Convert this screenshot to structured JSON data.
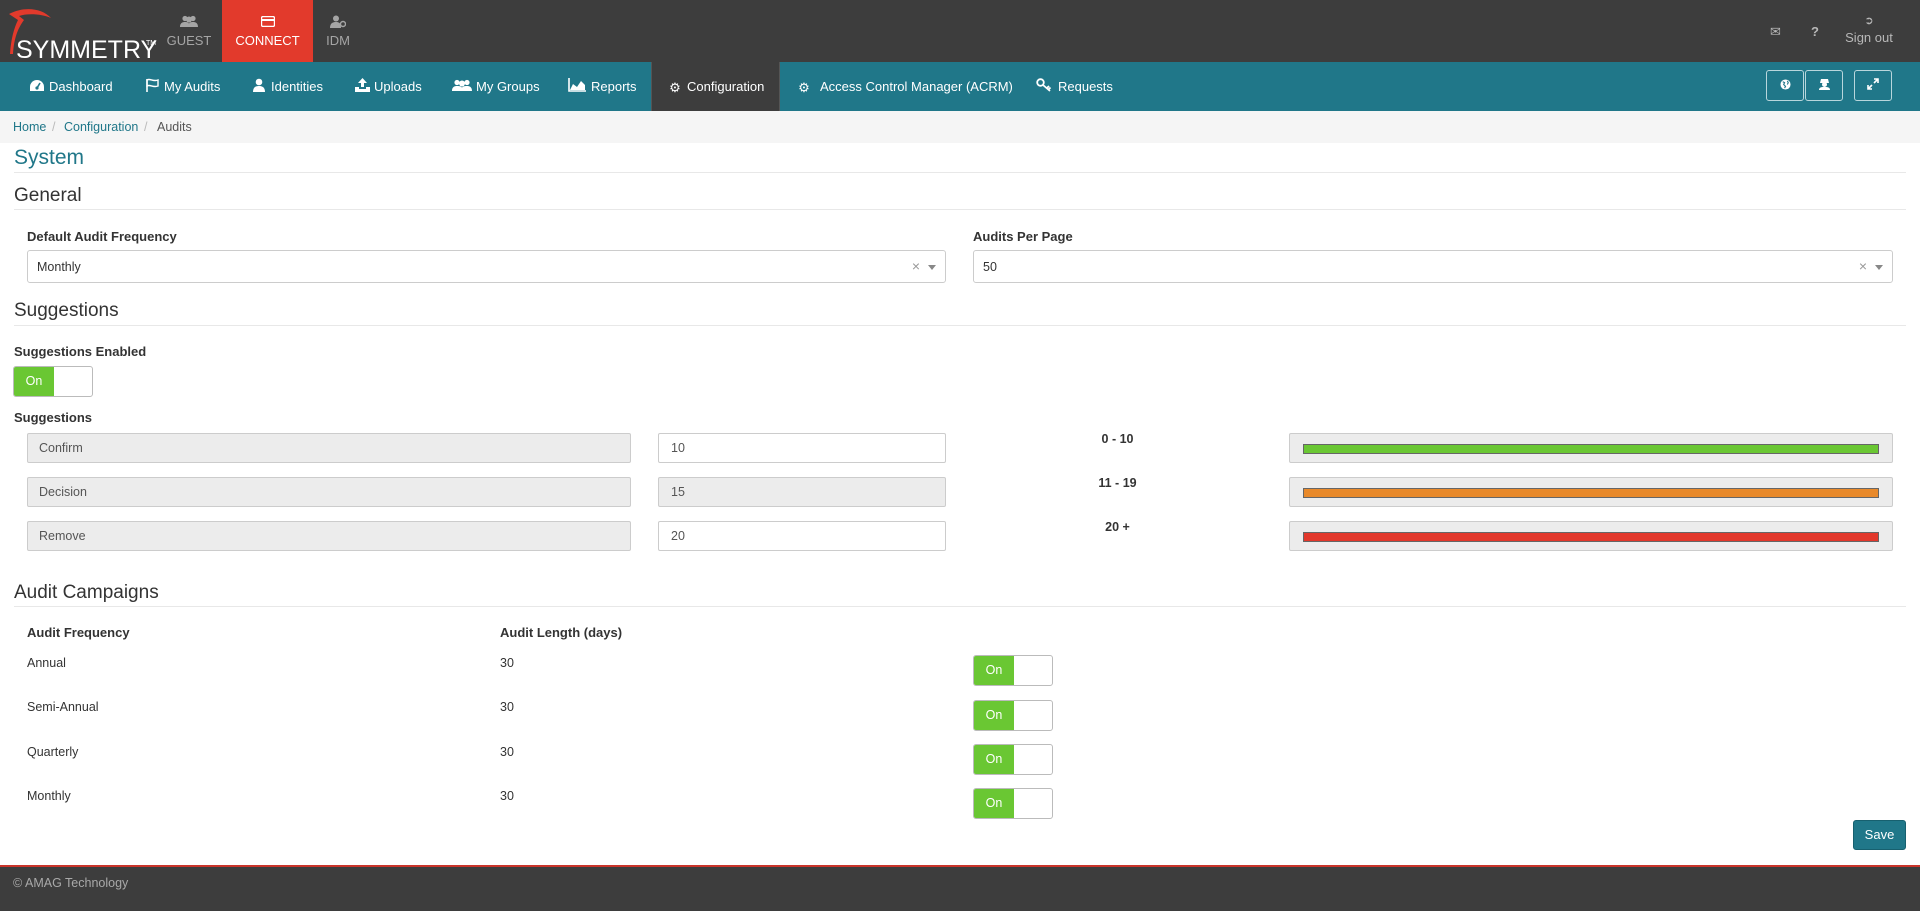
{
  "brand": {
    "name": "SYMMETRY",
    "tm": "TM"
  },
  "app_tabs": [
    {
      "label": "GUEST",
      "icon": "users-icon"
    },
    {
      "label": "CONNECT",
      "icon": "card-icon",
      "active": true
    },
    {
      "label": "IDM",
      "icon": "user-gear-icon"
    }
  ],
  "topbar": {
    "signout": "Sign out"
  },
  "nav": {
    "items": [
      {
        "label": "Dashboard",
        "icon": "dashboard-icon"
      },
      {
        "label": "My Audits",
        "icon": "flag-icon"
      },
      {
        "label": "Identities",
        "icon": "user-icon"
      },
      {
        "label": "Uploads",
        "icon": "upload-icon"
      },
      {
        "label": "My Groups",
        "icon": "group-icon"
      },
      {
        "label": "Reports",
        "icon": "area-chart-icon"
      },
      {
        "label": "Configuration",
        "icon": "gear-icon",
        "active": true
      },
      {
        "label": "Access Control Manager (ACRM)",
        "icon": "gear-icon"
      },
      {
        "label": "Requests",
        "icon": "key-icon"
      }
    ]
  },
  "breadcrumb": [
    "Home",
    "Configuration",
    "Audits"
  ],
  "page_title": "System",
  "general": {
    "title": "General",
    "freq_label": "Default Audit Frequency",
    "freq_value": "Monthly",
    "per_page_label": "Audits Per Page",
    "per_page_value": "50"
  },
  "suggestions": {
    "title": "Suggestions",
    "enabled_label": "Suggestions Enabled",
    "toggle_on": "On",
    "list_label": "Suggestions",
    "rows": [
      {
        "name": "Confirm",
        "value": "10",
        "range": "0 - 10",
        "color": "#6ac733"
      },
      {
        "name": "Decision",
        "value": "15",
        "range": "11 - 19",
        "color": "#e8892a"
      },
      {
        "name": "Remove",
        "value": "20",
        "range": "20 +",
        "color": "#e2382c"
      }
    ]
  },
  "campaigns": {
    "title": "Audit Campaigns",
    "col_freq": "Audit Frequency",
    "col_len": "Audit Length (days)",
    "toggle_on": "On",
    "rows": [
      {
        "freq": "Annual",
        "len": "30"
      },
      {
        "freq": "Semi-Annual",
        "len": "30"
      },
      {
        "freq": "Quarterly",
        "len": "30"
      },
      {
        "freq": "Monthly",
        "len": "30"
      }
    ]
  },
  "save_label": "Save",
  "footer": "© AMAG Technology",
  "colors": {
    "brand_red": "#e23a2c",
    "nav_teal": "#207789",
    "dark": "#3d3d3d",
    "toggle_green": "#6ac733"
  }
}
